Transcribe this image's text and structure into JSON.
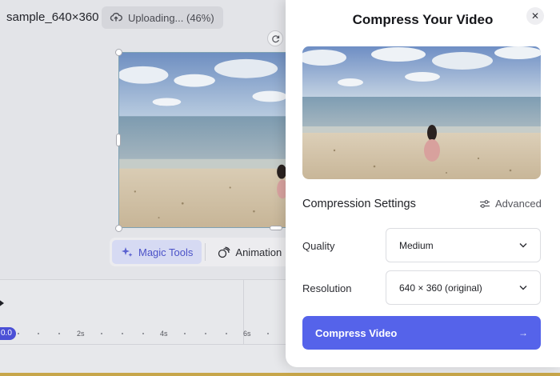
{
  "editor": {
    "file_name": "sample_640×360",
    "upload_status": "Uploading... (46%)",
    "upload_progress_percent": 46,
    "toolbar": {
      "magic_tools_label": "Magic Tools",
      "animation_label": "Animation"
    },
    "timeline": {
      "playhead_label": "0.0",
      "tick_labels": [
        "2s",
        "4s",
        "6s"
      ]
    }
  },
  "modal": {
    "title": "Compress Your Video",
    "close_glyph": "✕",
    "settings_title": "Compression Settings",
    "advanced_label": "Advanced",
    "quality": {
      "label": "Quality",
      "selected": "Medium"
    },
    "resolution": {
      "label": "Resolution",
      "selected": "640 × 360 (original)"
    },
    "submit_label": "Compress Video",
    "submit_arrow": "→"
  },
  "colors": {
    "accent": "#5563ea",
    "magic_tools_active": "#4b52c8",
    "playhead": "#4b50d6"
  },
  "icons": {
    "upload": "cloud-upload-icon",
    "rotate": "rotate-icon",
    "magic": "sparkle-icon",
    "animation": "animation-icon",
    "play": "play-icon",
    "close": "close-icon",
    "advanced": "sliders-icon",
    "dropdown": "chevron-down-icon",
    "submit": "arrow-right-icon"
  }
}
